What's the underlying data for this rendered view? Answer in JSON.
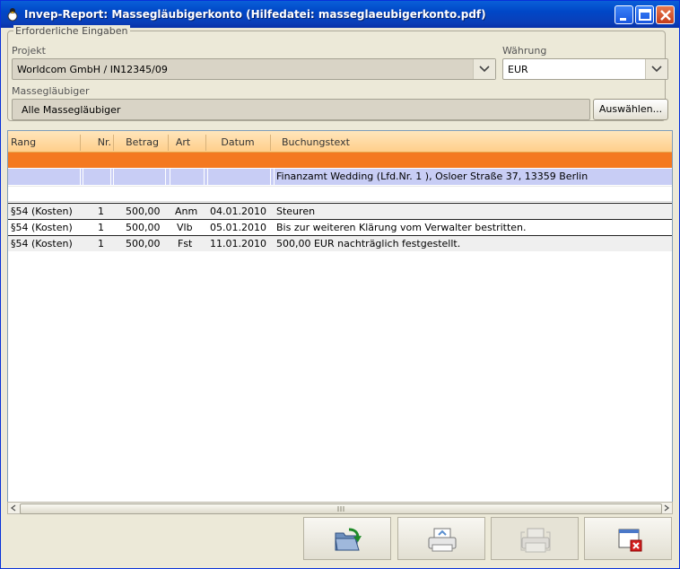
{
  "window": {
    "title": "Invep-Report: Massegläubigerkonto    (Hilfedatei: masseglaeubigerkonto.pdf)"
  },
  "form": {
    "group_label": "Erforderliche Eingaben",
    "projekt_label": "Projekt",
    "projekt_value": "Worldcom GmbH / IN12345/09",
    "waehrung_label": "Währung",
    "waehrung_value": "EUR",
    "glaeubiger_label": "Massegläubiger",
    "glaeubiger_value": "Alle Massegläubiger",
    "auswaehlen_label": "Auswählen..."
  },
  "table": {
    "columns": [
      "Rang",
      "Nr.",
      "Betrag",
      "Art",
      "Datum",
      "Buchungstext"
    ],
    "creditor_row": "Finanzamt Wedding (Lfd.Nr. 1 ), Osloer Straße 37, 13359 Berlin",
    "rows": [
      {
        "rang": "§54 (Kosten)",
        "nr": "1",
        "betrag": "500,00",
        "art": "Anm",
        "datum": "04.01.2010",
        "text": "Steuren"
      },
      {
        "rang": "§54 (Kosten)",
        "nr": "1",
        "betrag": "500,00",
        "art": "Vlb",
        "datum": "05.01.2010",
        "text": "Bis zur weiteren Klärung vom Verwalter bestritten."
      },
      {
        "rang": "§54 (Kosten)",
        "nr": "1",
        "betrag": "500,00",
        "art": "Fst",
        "datum": "11.01.2010",
        "text": "500,00 EUR nachträglich festgestellt."
      }
    ]
  },
  "colors": {
    "header_orange": "#ffcf8a",
    "group_band": "#f47920",
    "creditor_row": "#c8cdf5",
    "titlebar": "#0047c7"
  },
  "icons": {
    "export": "folder-export-icon",
    "print": "printer-icon",
    "print_disabled": "print-preview-icon",
    "close": "close-window-icon"
  }
}
